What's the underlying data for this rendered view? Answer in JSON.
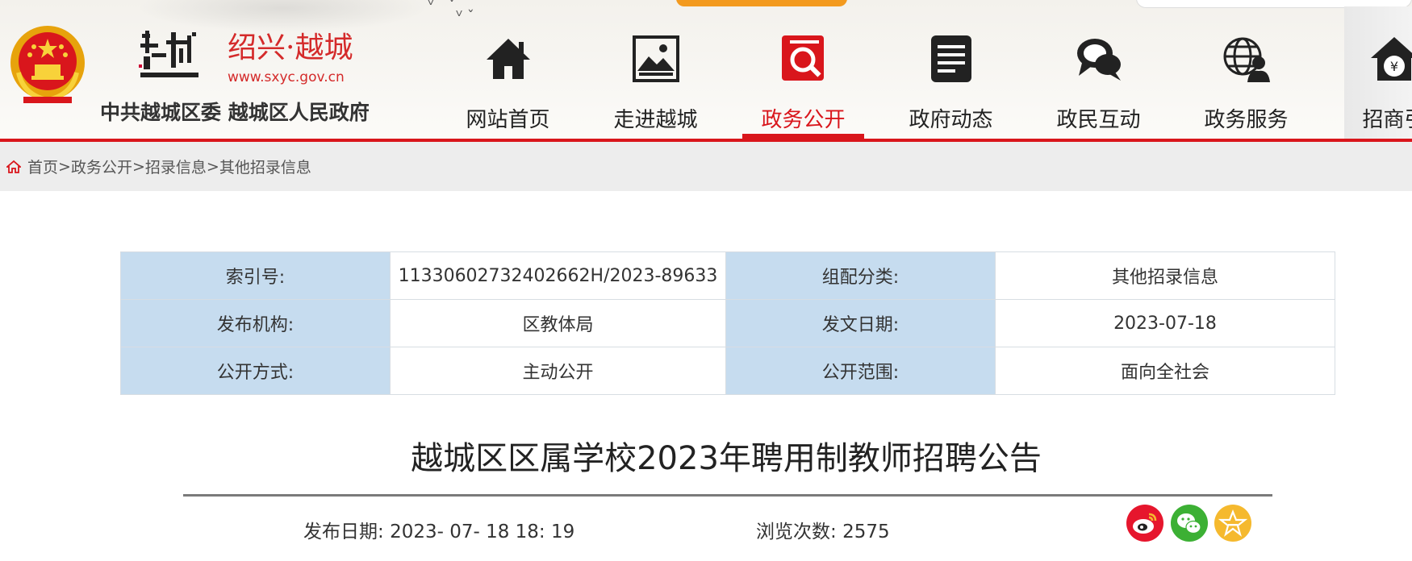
{
  "header": {
    "site_name": "绍兴·越城",
    "site_url": "www.sxyc.gov.cn",
    "gov_name": "中共越城区委 越城区人民政府",
    "nav": [
      {
        "label": "网站首页",
        "icon": "home-icon"
      },
      {
        "label": "走进越城",
        "icon": "picture-icon"
      },
      {
        "label": "政务公开",
        "icon": "search-document-icon",
        "active": true
      },
      {
        "label": "政府动态",
        "icon": "news-list-icon"
      },
      {
        "label": "政民互动",
        "icon": "chat-bubbles-icon"
      },
      {
        "label": "政务服务",
        "icon": "globe-user-icon"
      },
      {
        "label": "招商引",
        "icon": "money-house-icon"
      }
    ],
    "accent_color": "#d9161c"
  },
  "breadcrumb": {
    "items": [
      "首页",
      "政务公开",
      "招录信息",
      "其他招录信息"
    ],
    "separator": ">"
  },
  "info_table": [
    [
      {
        "label": "索引号:",
        "value": "11330602732402662H/2023-89633"
      },
      {
        "label": "组配分类:",
        "value": "其他招录信息"
      }
    ],
    [
      {
        "label": "发布机构:",
        "value": "区教体局"
      },
      {
        "label": "发文日期:",
        "value": "2023-07-18"
      }
    ],
    [
      {
        "label": "公开方式:",
        "value": "主动公开"
      },
      {
        "label": "公开范围:",
        "value": "面向全社会"
      }
    ]
  ],
  "article": {
    "title": "越城区区属学校2023年聘用制教师招聘公告",
    "publish_label": "发布日期:",
    "publish_date": "2023- 07- 18 18: 19",
    "views_label": "浏览次数:",
    "views": "2575"
  },
  "share": [
    {
      "name": "weibo-icon",
      "color": "#e6162d"
    },
    {
      "name": "wechat-icon",
      "color": "#3cb034"
    },
    {
      "name": "favorite-star-icon",
      "color": "#f5b92e"
    }
  ]
}
